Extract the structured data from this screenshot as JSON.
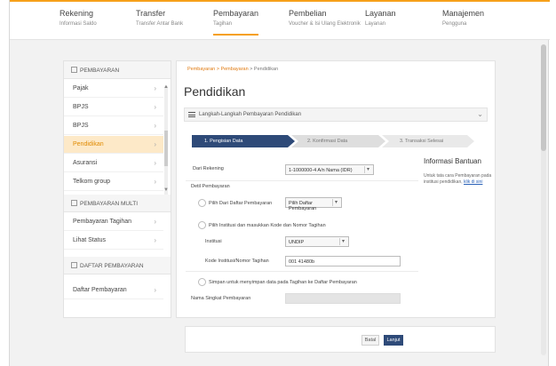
{
  "nav": {
    "items": [
      {
        "title": "Rekening",
        "sub": "Informasi Saldo"
      },
      {
        "title": "Transfer",
        "sub": "Transfer Antar Bank"
      },
      {
        "title": "Pembayaran",
        "sub": "Tagihan"
      },
      {
        "title": "Pembelian",
        "sub": "Voucher & Isi Ulang Elektronik"
      },
      {
        "title": "Layanan",
        "sub": "Layanan"
      },
      {
        "title": "Manajemen",
        "sub": "Pengguna"
      }
    ]
  },
  "sidebar": {
    "section1": "PEMBAYARAN",
    "items1": [
      "Pajak",
      "BPJS",
      "BPJS",
      "Pendidikan",
      "Asuransi",
      "Telkom group"
    ],
    "section2": "PEMBAYARAN MULTI",
    "items2": [
      "Pembayaran Tagihan",
      "Lihat Status"
    ],
    "section3": "DAFTAR PEMBAYARAN",
    "items3": [
      "Daftar Pembayaran"
    ]
  },
  "main": {
    "crumb_link": "Pembayaran > Pembayaran",
    "crumb_current": " > Pendidikan",
    "title": "Pendidikan",
    "list_label": "Langkah-Langkah Pembayaran Pendidikan",
    "steps": [
      "1. Pengisian Data",
      "2. Konfirmasi Data",
      "3. Transaksi Selesai"
    ]
  },
  "form": {
    "account_label": "Dari Rekening",
    "account_value": "1-1000000-4 A/n Nama (IDR)",
    "section_label": "Detil Pembayaran",
    "opt1_label": "Pilih Dari Daftar Pembayaran",
    "opt1_select": "Pilih Daftar Pembayaran",
    "opt2_label": "Pilih Institusi dan masukkan Kode dan Nomor Tagihan",
    "institution_label": "Institusi",
    "institution_value": "UNDIP",
    "nomor_label": "Kode Institusi/Nomor Tagihan",
    "nomor_value": "001 41480b",
    "opt3_label": "Simpan untuk menyimpan data pada Tagihan ke Daftar Pembayaran",
    "nick_label": "Nama Singkat Pembayaran"
  },
  "info": {
    "heading": "Informasi Bantuan",
    "text": "Untuk tata cara Pembayaran pada institusi pendidikan, ",
    "link": "klik di sini"
  },
  "buttons": {
    "back": "Batal",
    "next": "Lanjut"
  },
  "colors": {
    "accent": "#f6a01a",
    "primary": "#2e4a78",
    "link": "#2b62b8"
  }
}
